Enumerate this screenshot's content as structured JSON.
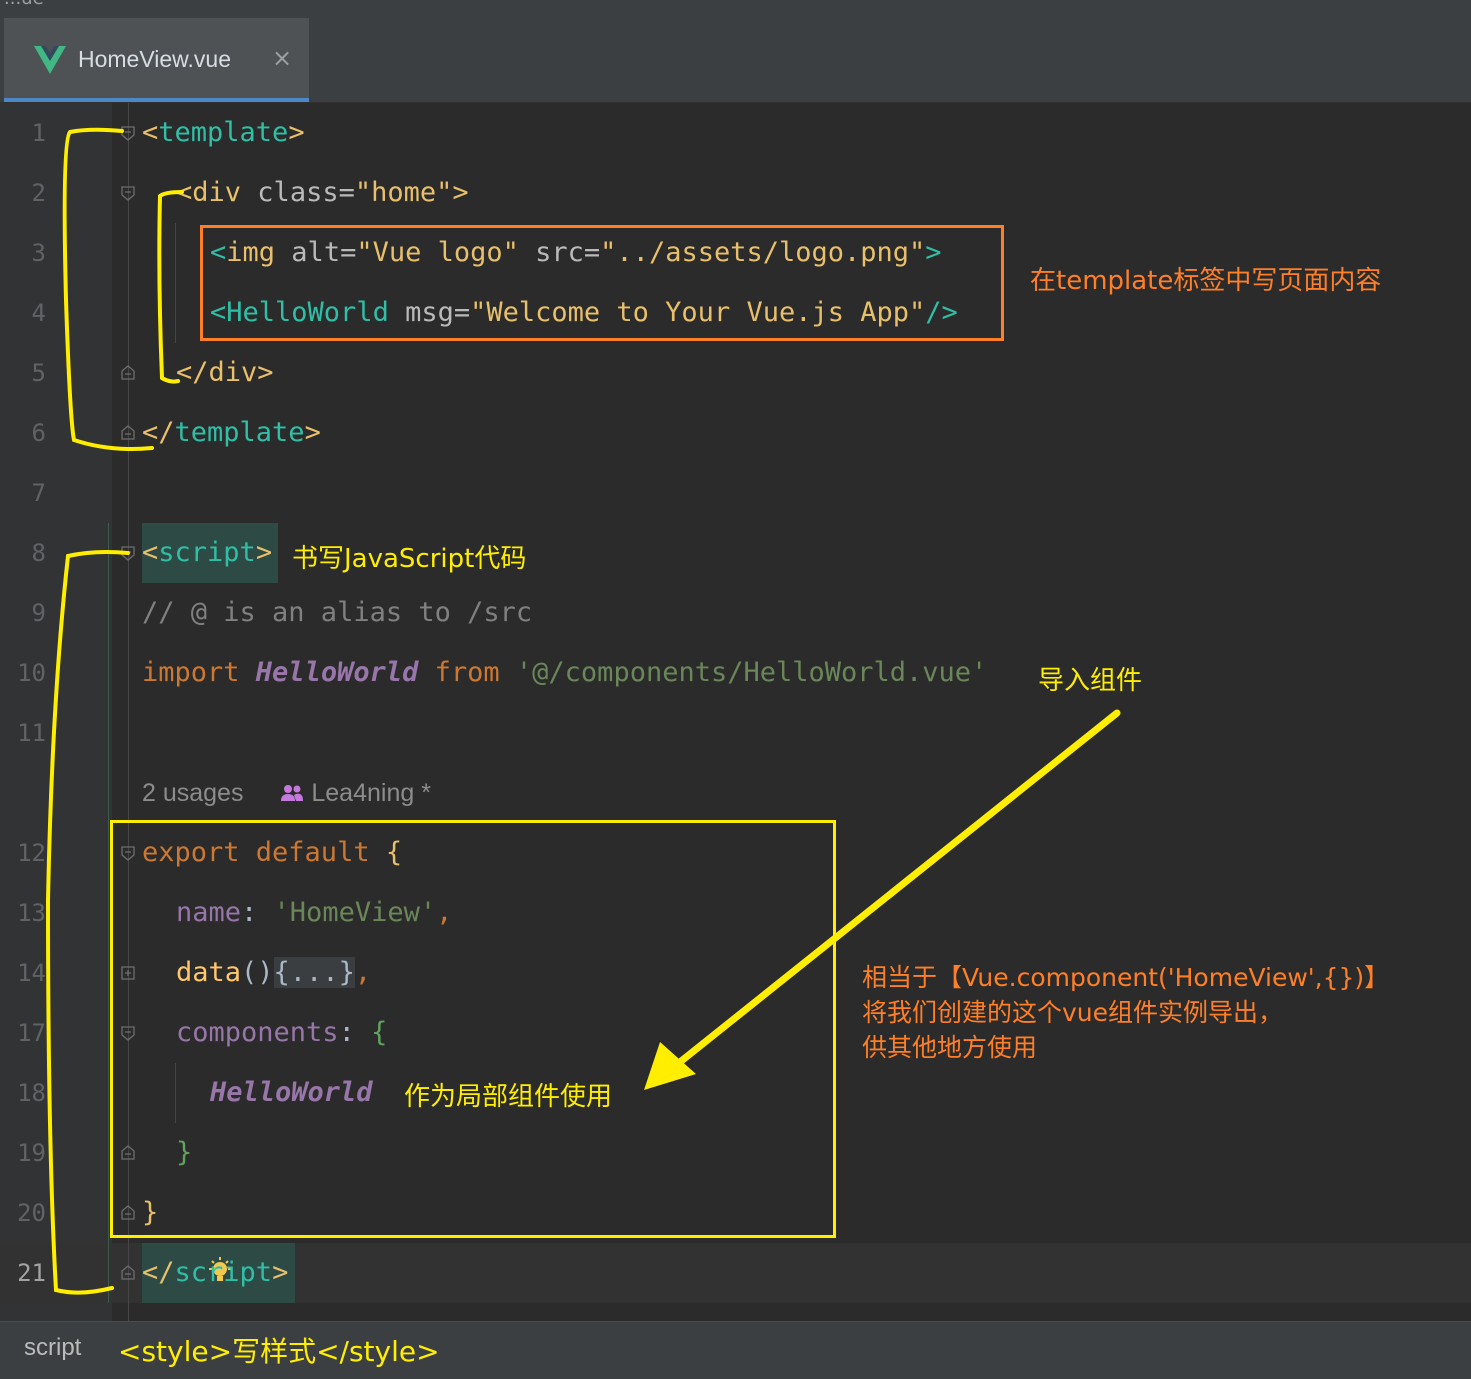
{
  "window": {
    "title_fragment": "...ue"
  },
  "tab": {
    "label": "HomeView.vue",
    "close_glyph": "×"
  },
  "line_numbers": [
    "1",
    "2",
    "3",
    "4",
    "5",
    "6",
    "7",
    "8",
    "9",
    "10",
    "11",
    "12",
    "13",
    "14",
    "17",
    "18",
    "19",
    "20",
    "21"
  ],
  "code": {
    "l1": {
      "open": "<",
      "tag": "template",
      "close": ">"
    },
    "l2": {
      "open": "<",
      "tag": "div",
      "attr": " class=",
      "value": "\"home\"",
      "close": ">"
    },
    "l3": {
      "open": "<",
      "tag": "img",
      "attr1": " alt=",
      "val1": "\"Vue logo\"",
      "attr2": " src=",
      "val2": "\"../assets/logo.png\"",
      "close": ">"
    },
    "l4": {
      "open": "<",
      "tag": "HelloWorld",
      "attr": " msg=",
      "value": "\"Welcome to Your Vue.js App\"",
      "close": "/>"
    },
    "l5": {
      "open": "</",
      "tag": "div",
      "close": ">"
    },
    "l6": {
      "open": "</",
      "tag": "template",
      "close": ">"
    },
    "l8": {
      "open": "<",
      "tag": "script",
      "close": ">"
    },
    "l9": {
      "comment": "// @ is an alias to /src"
    },
    "l10": {
      "kw1": "import ",
      "cls": "HelloWorld",
      "kw2": " from ",
      "str": "'@/components/HelloWorld.vue'"
    },
    "l12": {
      "kw": "export default ",
      "brace": "{"
    },
    "l13": {
      "prop": "name",
      "colon": ": ",
      "str": "'HomeView'",
      "comma": ","
    },
    "l14": {
      "fn": "data",
      "paren": "()",
      "folded": "{...}",
      "comma": ","
    },
    "l17": {
      "prop": "components",
      "colon": ": ",
      "brace": "{"
    },
    "l18": {
      "cls": "HelloWorld"
    },
    "l19": {
      "brace": "}"
    },
    "l20": {
      "brace": "}"
    },
    "l21": {
      "open": "</",
      "tag": "script",
      "close": ">"
    }
  },
  "inlay_hint": {
    "usages": "2 usages",
    "author": "Lea4ning *"
  },
  "annotations": {
    "template_note": "在template标签中写页面内容",
    "script_note": "书写JavaScript代码",
    "import_note": "导入组件",
    "local_component_note": "作为局部组件使用",
    "export_note_lines": [
      "相当于【Vue.component('HomeView',{})】",
      "将我们创建的这个vue组件实例导出，",
      "供其他地方使用"
    ],
    "style_note": "<style>写样式</style>"
  },
  "statusbar": {
    "breadcrumb": "script"
  },
  "colors": {
    "annotation_orange": "#ff7f27",
    "annotation_yellow": "#ffee00",
    "editor_bg": "#2b2b2b",
    "tag_name": "#2fbfa7",
    "string": "#6a8759",
    "keyword": "#cc7832"
  },
  "icons": [
    "vue-logo-icon",
    "close-icon",
    "fold-marker-icon",
    "users-icon",
    "lightbulb-icon"
  ]
}
